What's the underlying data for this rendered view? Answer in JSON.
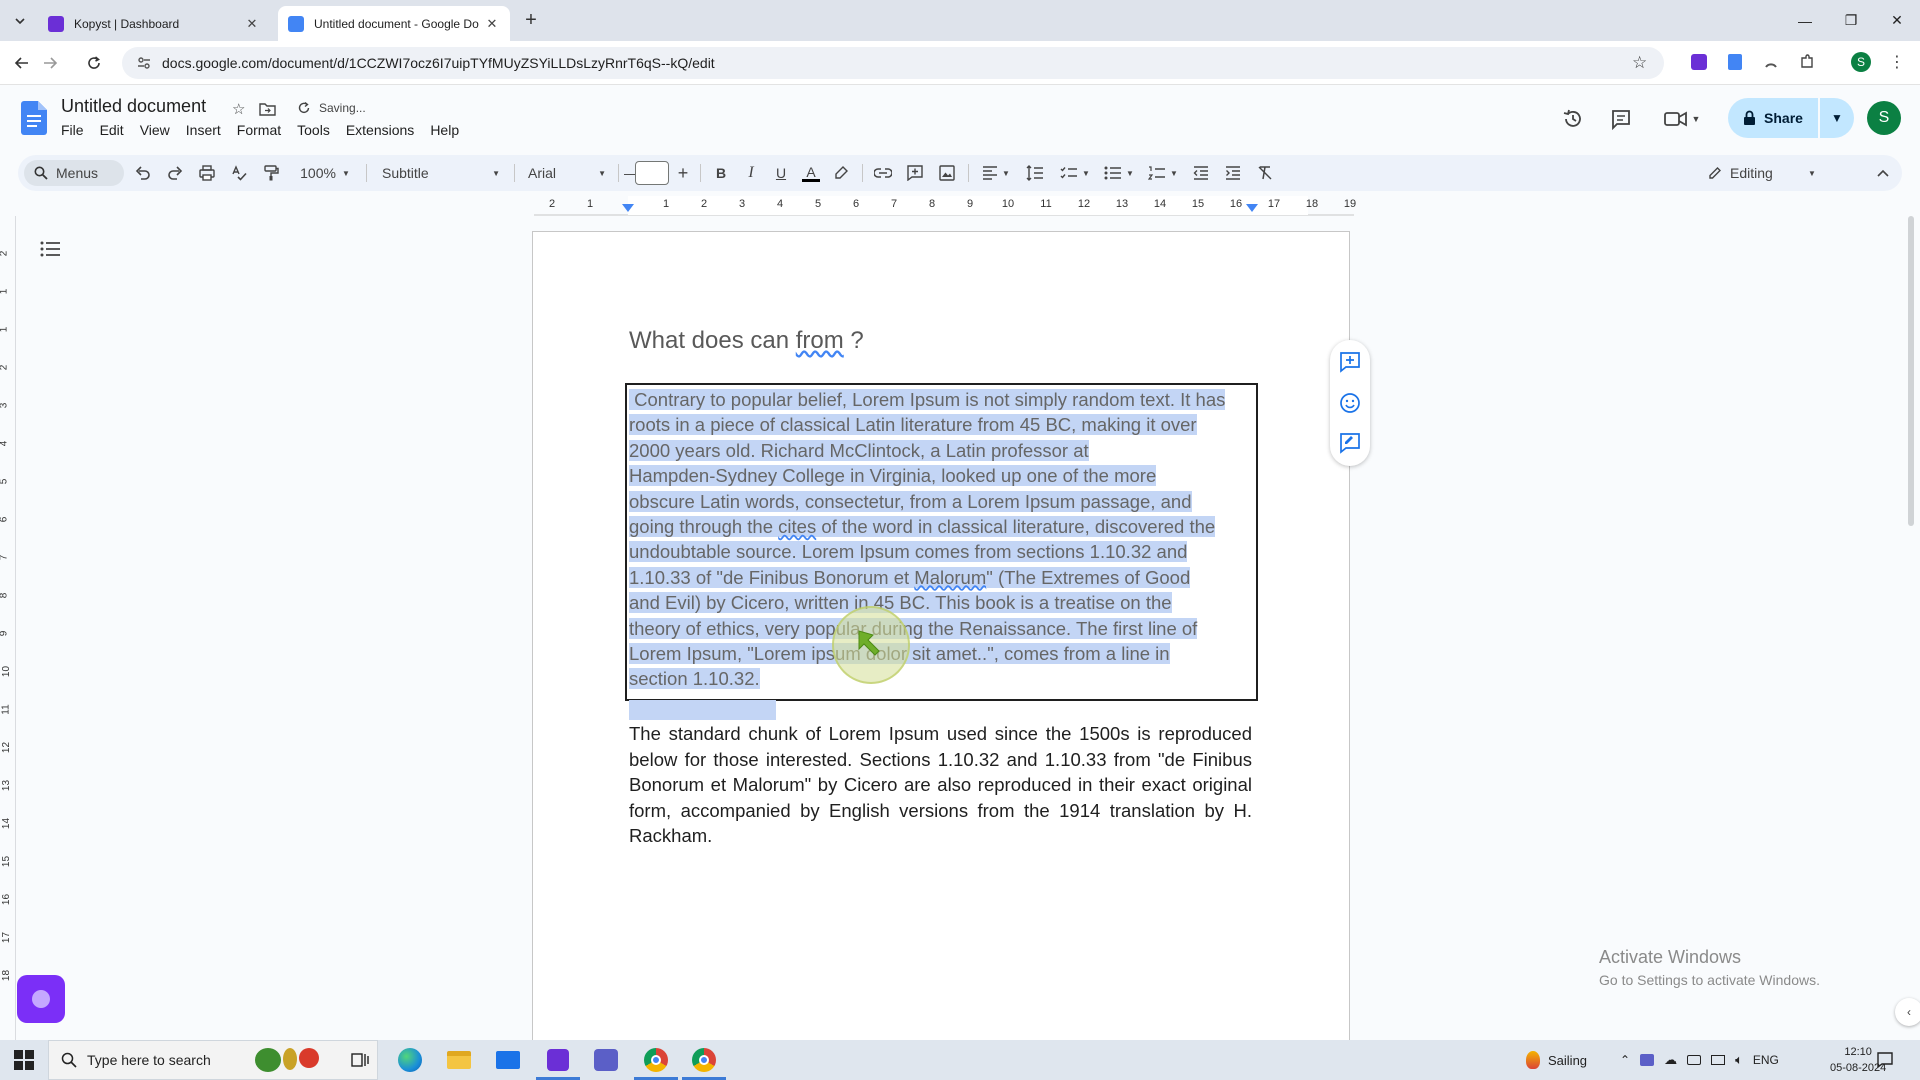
{
  "browser": {
    "tabs": [
      {
        "title": "Kopyst | Dashboard",
        "active": false,
        "favicon_color": "#6b2fd6"
      },
      {
        "title": "Untitled document - Google Do",
        "active": true,
        "favicon_color": "#4285f4"
      }
    ],
    "url": "docs.google.com/document/d/1CCZWI7ocz6I7uipTYfMUyZSYiLLDsLzyRnrT6qS--kQ/edit",
    "profile_initial": "S"
  },
  "docs": {
    "title": "Untitled document",
    "status": "Saving...",
    "menu": [
      "File",
      "Edit",
      "View",
      "Insert",
      "Format",
      "Tools",
      "Extensions",
      "Help"
    ],
    "share_label": "Share",
    "account_initial": "S"
  },
  "toolbar": {
    "search_label": "Menus",
    "zoom": "100%",
    "style": "Subtitle",
    "font": "Arial",
    "font_size": "",
    "mode": "Editing"
  },
  "ruler": {
    "h_labels": [
      "2",
      "1",
      "1",
      "2",
      "3",
      "4",
      "5",
      "6",
      "7",
      "8",
      "9",
      "10",
      "11",
      "12",
      "13",
      "14",
      "15",
      "16",
      "17",
      "18",
      "19"
    ],
    "v_labels": [
      "2",
      "1",
      "1",
      "2",
      "3",
      "4",
      "5",
      "6",
      "7",
      "8",
      "9",
      "10",
      "11",
      "12",
      "13",
      "14",
      "15",
      "16",
      "17",
      "18"
    ]
  },
  "document": {
    "subtitle_prefix": "What does can ",
    "subtitle_spell": "from",
    "subtitle_suffix": " ?",
    "para1_lines": [
      " Contrary to popular belief, Lorem Ipsum is not simply random text. It has",
      "roots in a piece of classical Latin literature from 45 BC, making it over",
      "2000 years old. Richard McClintock, a Latin professor at",
      "Hampden-Sydney College in Virginia, looked up one of the more",
      "obscure Latin words, consectetur, from a Lorem Ipsum passage, and",
      "going through the ",
      "cites",
      " of the word in classical literature, discovered the",
      "undoubtable source. Lorem Ipsum comes from sections 1.10.32 and",
      "1.10.33 of \"de Finibus Bonorum et ",
      "Malorum",
      "\" (The Extremes of Good",
      "and Evil) by Cicero, written in 45 BC. This book is a treatise on the",
      "theory of ethics, very popular during the Renaissance. The first line of",
      "Lorem Ipsum, \"Lorem ipsum dolor sit amet..\", comes from a line in",
      "section 1.10.32."
    ],
    "para2": "The standard chunk of Lorem Ipsum used since the 1500s is reproduced below for those interested. Sections 1.10.32 and 1.10.33 from \"de Finibus Bonorum et Malorum\" by Cicero are also reproduced in their exact original form, accompanied by English versions from the 1914 translation by H. Rackham."
  },
  "watermark": {
    "line1": "Activate Windows",
    "line2": "Go to Settings to activate Windows."
  },
  "taskbar": {
    "search_placeholder": "Type here to search",
    "weather": "Sailing",
    "lang": "ENG",
    "time": "12:10",
    "date": "05-08-2024"
  }
}
